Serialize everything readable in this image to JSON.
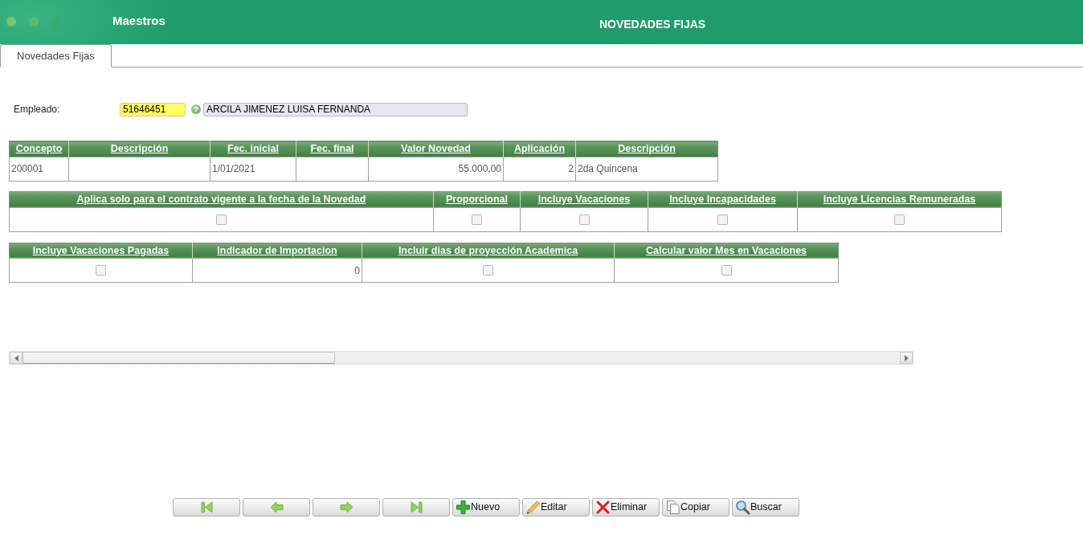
{
  "header": {
    "section": "Maestros",
    "title": "NOVEDADES FIJAS"
  },
  "tabs": [
    {
      "label": "Novedades Fijas",
      "selected": true
    }
  ],
  "employee": {
    "label": "Empleado:",
    "code": "51646451",
    "help": "?",
    "name": "ARCILA JIMENEZ LUISA FERNANDA"
  },
  "tables": [
    {
      "columns": [
        "Concepto",
        "Descripción",
        "Fec. inicial",
        "Fec. final",
        "Valor Novedad",
        "Aplicación",
        "Descripción"
      ],
      "rows": [
        [
          {
            "kind": "text",
            "text": "200001"
          },
          {
            "kind": "empty"
          },
          {
            "kind": "text",
            "text": "1/01/2021"
          },
          {
            "kind": "empty"
          },
          {
            "kind": "number",
            "text": "55.000,00"
          },
          {
            "kind": "number",
            "text": "2"
          },
          {
            "kind": "text",
            "text": "2da Quincena"
          }
        ]
      ]
    },
    {
      "columns": [
        "Aplica solo para el contrato vigente a la fecha de la Novedad",
        "Proporcional",
        "Incluye Vacaciones",
        "Incluye Incapacidades",
        "Incluye Licencias Remuneradas"
      ],
      "rows": [
        [
          {
            "kind": "checkbox",
            "checked": false
          },
          {
            "kind": "checkbox",
            "checked": false
          },
          {
            "kind": "checkbox",
            "checked": false
          },
          {
            "kind": "checkbox",
            "checked": false
          },
          {
            "kind": "checkbox",
            "checked": false
          }
        ]
      ]
    },
    {
      "columns": [
        "Incluye Vacaciones Pagadas",
        "Indicador de Importacion",
        "Incluir dias de proyección Academica",
        "Calcular valor Mes en Vacaciones"
      ],
      "rows": [
        [
          {
            "kind": "checkbox",
            "checked": false
          },
          {
            "kind": "number",
            "text": "0"
          },
          {
            "kind": "checkbox",
            "checked": false
          },
          {
            "kind": "checkbox",
            "checked": false
          }
        ]
      ]
    }
  ],
  "toolbar": [
    {
      "kind": "first"
    },
    {
      "kind": "previous"
    },
    {
      "kind": "next"
    },
    {
      "kind": "last"
    },
    {
      "kind": "new",
      "label": "Nuevo"
    },
    {
      "kind": "edit",
      "label": "Editar"
    },
    {
      "kind": "delete",
      "label": "Eliminar"
    },
    {
      "kind": "copy",
      "label": "Copiar"
    },
    {
      "kind": "search",
      "label": "Buscar"
    }
  ]
}
